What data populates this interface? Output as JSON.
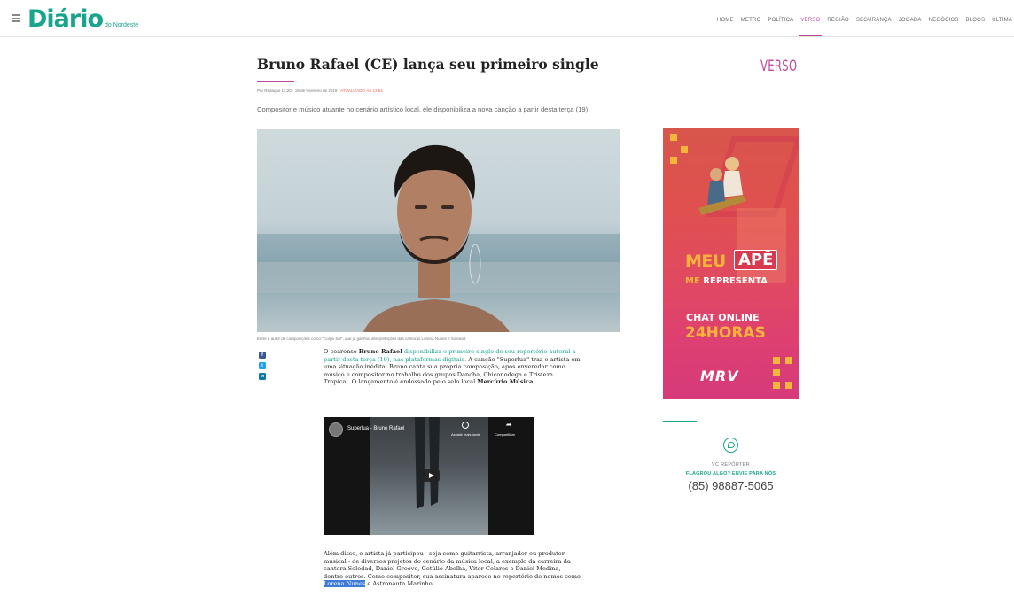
{
  "header": {
    "logo_main": "Diário",
    "logo_sub": "do Nordeste",
    "nav": [
      "HOME",
      "METRO",
      "POLÍTICA",
      "VERSO",
      "REGIÃO",
      "SEGURANÇA",
      "JOGADA",
      "NEGÓCIOS",
      "BLOGS",
      "ÚLTIMA"
    ],
    "active_nav": "VERSO",
    "accent_color": "#c0449a",
    "brand_color": "#18a58b"
  },
  "article": {
    "section_brand": "VERSO",
    "title": "Bruno Rafael (CE) lança seu primeiro single",
    "byline_author": "Por Redação",
    "byline_date": "12:20 · 19 de fevereiro de 2019 ·",
    "byline_updated": "ATUALIZADO ÀS 12:54",
    "subtitle": "Compositor e músico atuante no cenário artístico local, ele disponibiliza a nova canção a partir desta terça (19)",
    "photo_caption": "Entre é autor de composições como \"Corpo Sol\", que já ganhou interpretações das cantoras Lorena Nunes e Soledad",
    "p1_a": "O cearense ",
    "p1_name": "Bruno Rafael",
    "p1_link": " disponibiliza o primeiro single de seu repertório autoral a partir desta terça (19), nas plataformas digitais.",
    "p1_b": " A canção \"Superlua\" traz o artista em uma situação inédita: Bruno canta sua própria composição, após enveredar como músico e compositor no trabalho dos grupos Dancha, Chiconodega e Tristeza Tropical. O lançamento é endossado pelo selo local ",
    "p1_label": "Mercúrio Música",
    "p1_end": ".",
    "p2_a": "Além disso, o artista já participou - seja como guitarrista, arranjador ou produtor musical - de diversos projetos do cenário da música local, a exemplo da carreira da cantora Soledad, Daniel Groove, Getúlio Abelha, Vitor Colares e Daniel Medina, dentre outros. Como compositor, sua assinatura aparece no repertório de nomes como ",
    "p2_sel": "Lorena Nunes",
    "p2_b": " e Astronauta Marinho."
  },
  "video": {
    "title": "Superlua - Bruno Rafael",
    "watch_later": "Assistir mais tarde",
    "share": "Compartilhar"
  },
  "ad": {
    "line1": "MEU",
    "line1_box": "APÊ",
    "line2_a": "ME",
    "line2_b": "REPRESENTA",
    "line3": "CHAT ONLINE",
    "line4": "24HORAS",
    "brand": "MRV"
  },
  "sidebar": {
    "vc_label": "VC REPÓRTER",
    "cta": "FLAGROU ALGO? ENVIE PARA NÓS",
    "phone": "(85) 98887-5065"
  }
}
